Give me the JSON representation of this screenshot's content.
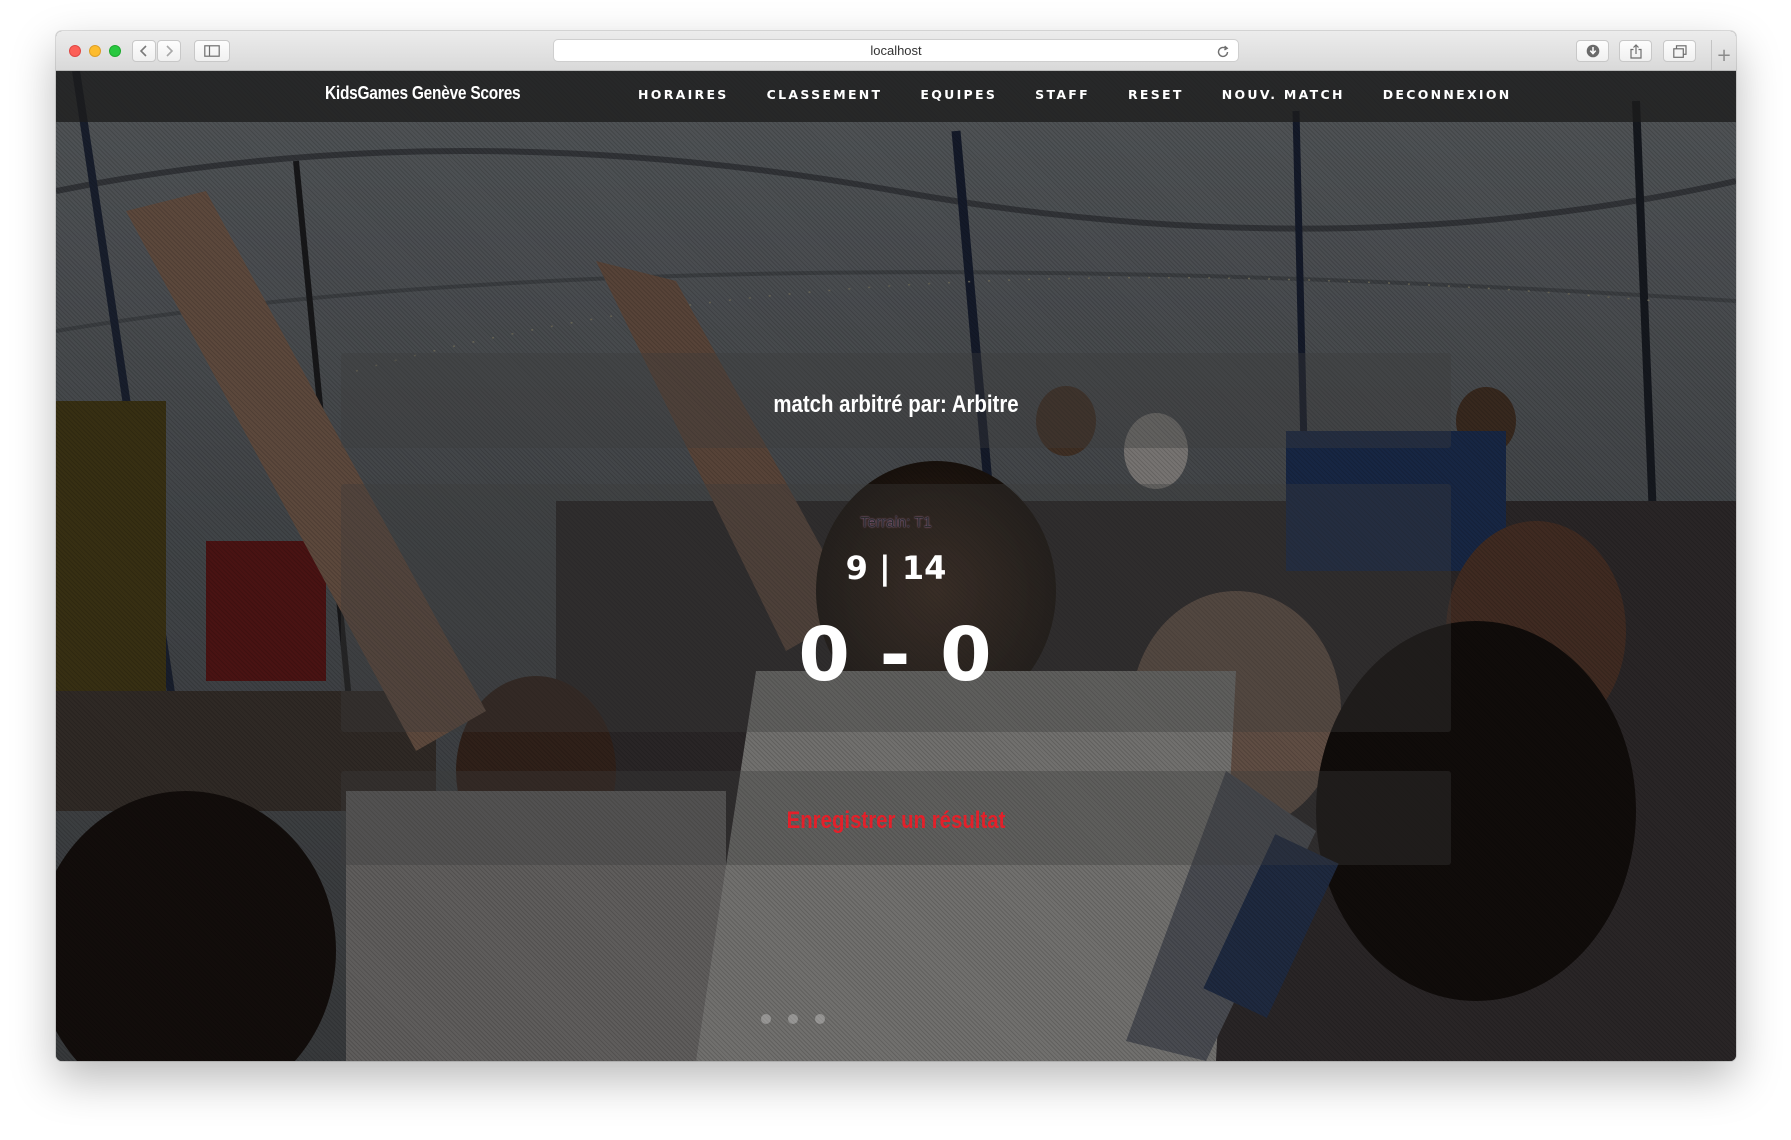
{
  "browser": {
    "url": "localhost",
    "controls": {
      "back": "chevron-left-icon",
      "forward": "chevron-right-icon",
      "sidebar": "sidebar-icon",
      "reload": "reload-icon",
      "download": "download-icon",
      "share": "share-icon",
      "tabs": "tabs-icon",
      "new_tab": "+"
    }
  },
  "navbar": {
    "brand": "KidsGames Genève Scores",
    "items": [
      {
        "label": "HORAIRES"
      },
      {
        "label": "CLASSEMENT"
      },
      {
        "label": "EQUIPES"
      },
      {
        "label": "STAFF"
      },
      {
        "label": "RESET"
      },
      {
        "label": "NOUV. MATCH"
      },
      {
        "label": "DECONNEXION"
      }
    ]
  },
  "match": {
    "referee_line": "match arbitré par: Arbitre",
    "terrain": "Terrain: T1",
    "teams": "9 | 14",
    "score": "0 - 0",
    "action_label": "Enregistrer un résultat"
  },
  "colors": {
    "accent_red": "#e3202a",
    "nav_bg": "#1c1c1c"
  },
  "carousel": {
    "slide_count": 3
  }
}
